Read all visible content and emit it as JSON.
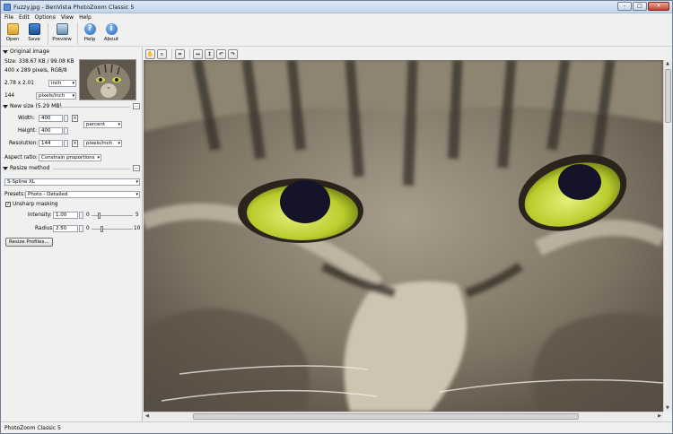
{
  "window": {
    "title": "Fuzzy.jpg - BenVista PhotoZoom Classic 5"
  },
  "menu": [
    "File",
    "Edit",
    "Options",
    "View",
    "Help"
  ],
  "toolbar": [
    {
      "label": "Open",
      "icon": "folder-open-icon",
      "color": "#e8b84a"
    },
    {
      "label": "Save",
      "icon": "floppy-disk-icon",
      "color": "#2d6cb8"
    },
    {
      "label": "Preview",
      "icon": "preview-icon",
      "color": "#6a8fb0"
    },
    {
      "label": "Help",
      "icon": "help-icon",
      "color": "#2f7fd6"
    },
    {
      "label": "About",
      "icon": "info-icon",
      "color": "#2f7fd6"
    }
  ],
  "original": {
    "header": "Original image",
    "size": "Size: 338.67 KB / 99.08 KB",
    "pixels": "400 x 289 pixels, RGB/8",
    "dims": "2.78 x 2.01",
    "dims_unit": "inch",
    "res": "144",
    "res_unit": "pixels/inch"
  },
  "newsize": {
    "header": "New size (5.29 MB)",
    "width_label": "Width:",
    "width": "400",
    "height_label": "Height:",
    "height": "400",
    "unit": "percent",
    "res_label": "Resolution:",
    "res": "144",
    "res_unit": "pixels/inch",
    "aspect_label": "Aspect ratio:",
    "aspect": "Constrain proportions"
  },
  "resize": {
    "header": "Resize method",
    "method": "S-Spline XL",
    "presets_label": "Presets:",
    "preset": "Photo - Detailed",
    "unsharp_label": "Unsharp masking",
    "unsharp_checked": true,
    "intensity_label": "Intensity:",
    "intensity": "1.00",
    "intensity_min": "0",
    "intensity_max": "5",
    "intensity_fraction": 0.2,
    "radius_label": "Radius:",
    "radius": "2.50",
    "radius_min": "0",
    "radius_max": "10",
    "radius_fraction": 0.25,
    "profiles_button": "Resize Profiles..."
  },
  "status": "PhotoZoom Classic 5"
}
